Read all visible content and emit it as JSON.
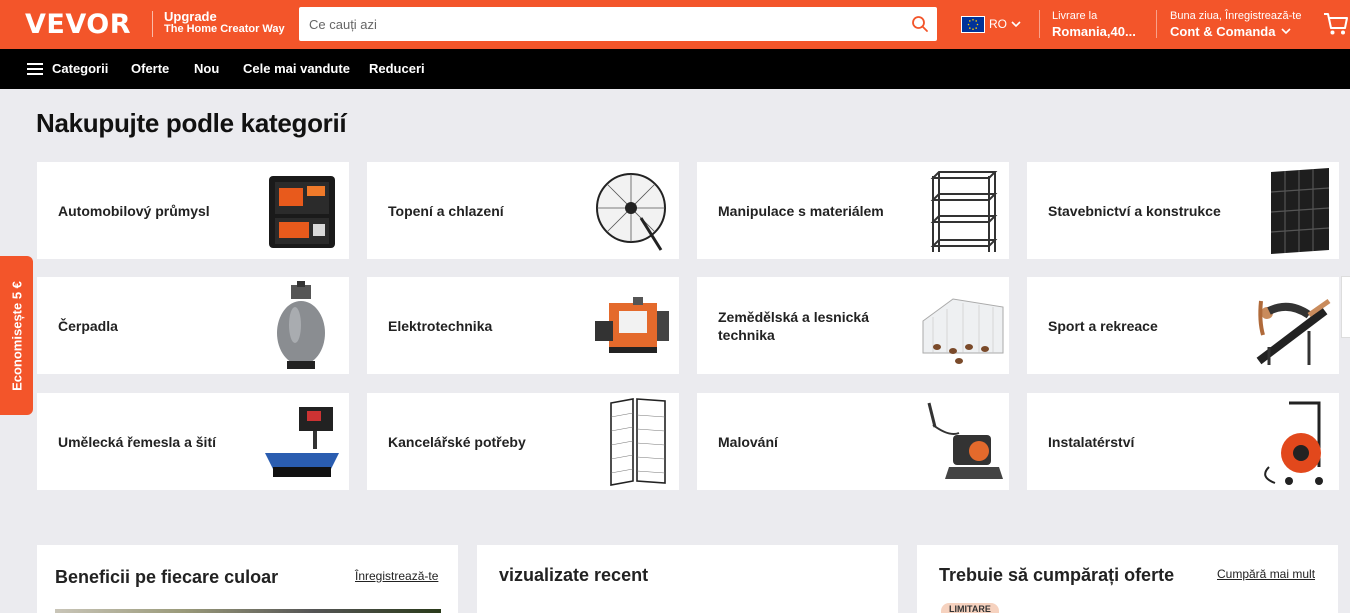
{
  "header": {
    "logo": "VEVOR",
    "tagline_line1": "Upgrade",
    "tagline_line2": "The Home Creator Way",
    "search_placeholder": "Ce cauți azi",
    "region": "RO",
    "delivery_line1": "Livrare la",
    "delivery_line2": "Romania,40...",
    "account_line1": "Buna ziua, Înregistrează-te",
    "account_line2": "Cont & Comanda",
    "colors": {
      "brand": "#f3552a",
      "nav": "#000000"
    }
  },
  "nav": {
    "items": [
      "Categorii",
      "Oferte",
      "Nou",
      "Cele mai vandute",
      "Reduceri"
    ]
  },
  "section": {
    "title": "Nakupujte podle kategorií"
  },
  "categories": [
    {
      "label": "Automobilový průmysl",
      "icon": "toolkit-case-icon"
    },
    {
      "label": "Topení a chlazení",
      "icon": "wall-fan-icon"
    },
    {
      "label": "Manipulace s materiálem",
      "icon": "metal-shelf-icon"
    },
    {
      "label": "Stavebnictví a konstrukce",
      "icon": "floor-tile-icon"
    },
    {
      "label": "Čerpadla",
      "icon": "sand-filter-icon"
    },
    {
      "label": "Elektrotechnika",
      "icon": "wire-stripper-icon"
    },
    {
      "label": "Zemědělská a lesnická technika",
      "icon": "chicken-coop-icon"
    },
    {
      "label": "Sport a rekreace",
      "icon": "sit-up-bench-icon"
    },
    {
      "label": "Umělecká řemesla a šití",
      "icon": "heat-press-icon"
    },
    {
      "label": "Kancelářské potřeby",
      "icon": "grid-panel-icon"
    },
    {
      "label": "Malování",
      "icon": "paint-sprayer-icon"
    },
    {
      "label": "Instalatérství",
      "icon": "drain-cleaner-icon"
    }
  ],
  "side_tab": {
    "label": "Economisește 5 €"
  },
  "panels": [
    {
      "title": "Beneficii pe fiecare culoar",
      "link": "Înregistrează-te"
    },
    {
      "title": "vizualizate recent",
      "link": ""
    },
    {
      "title": "Trebuie să cumpărați oferte",
      "link": "Cumpără mai mult",
      "badge": "LIMITARE"
    }
  ]
}
